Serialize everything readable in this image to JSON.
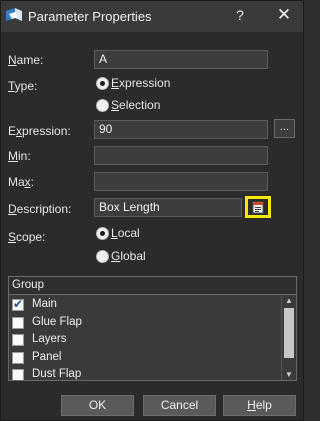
{
  "window": {
    "title": "Parameter Properties",
    "app_icon": "app-logo-icon",
    "help_glyph": "?",
    "close_glyph": "✕"
  },
  "form": {
    "name_label": "Name:",
    "name_value": "A",
    "type_label": "Type:",
    "type_options": [
      {
        "label": "Expression",
        "checked": true
      },
      {
        "label": "Selection",
        "checked": false
      }
    ],
    "expression_label": "Expression:",
    "expression_value": "90",
    "expression_button": "...",
    "min_label": "Min:",
    "min_value": "",
    "max_label": "Max:",
    "max_value": "",
    "description_label": "Description:",
    "description_value": "Box Length",
    "description_button_icon": "edit-document-icon",
    "scope_label": "Scope:",
    "scope_options": [
      {
        "label": "Local",
        "checked": true
      },
      {
        "label": "Global",
        "checked": false
      }
    ]
  },
  "group": {
    "header": "Group",
    "items": [
      {
        "label": "Main",
        "checked": true
      },
      {
        "label": "Glue Flap",
        "checked": false
      },
      {
        "label": "Layers",
        "checked": false
      },
      {
        "label": "Panel",
        "checked": false
      },
      {
        "label": "Dust Flap",
        "checked": false
      }
    ]
  },
  "buttons": {
    "ok": "OK",
    "cancel": "Cancel",
    "help": "Help"
  },
  "colors": {
    "highlight_border": "#f6e804",
    "background": "#2b2b2b"
  }
}
